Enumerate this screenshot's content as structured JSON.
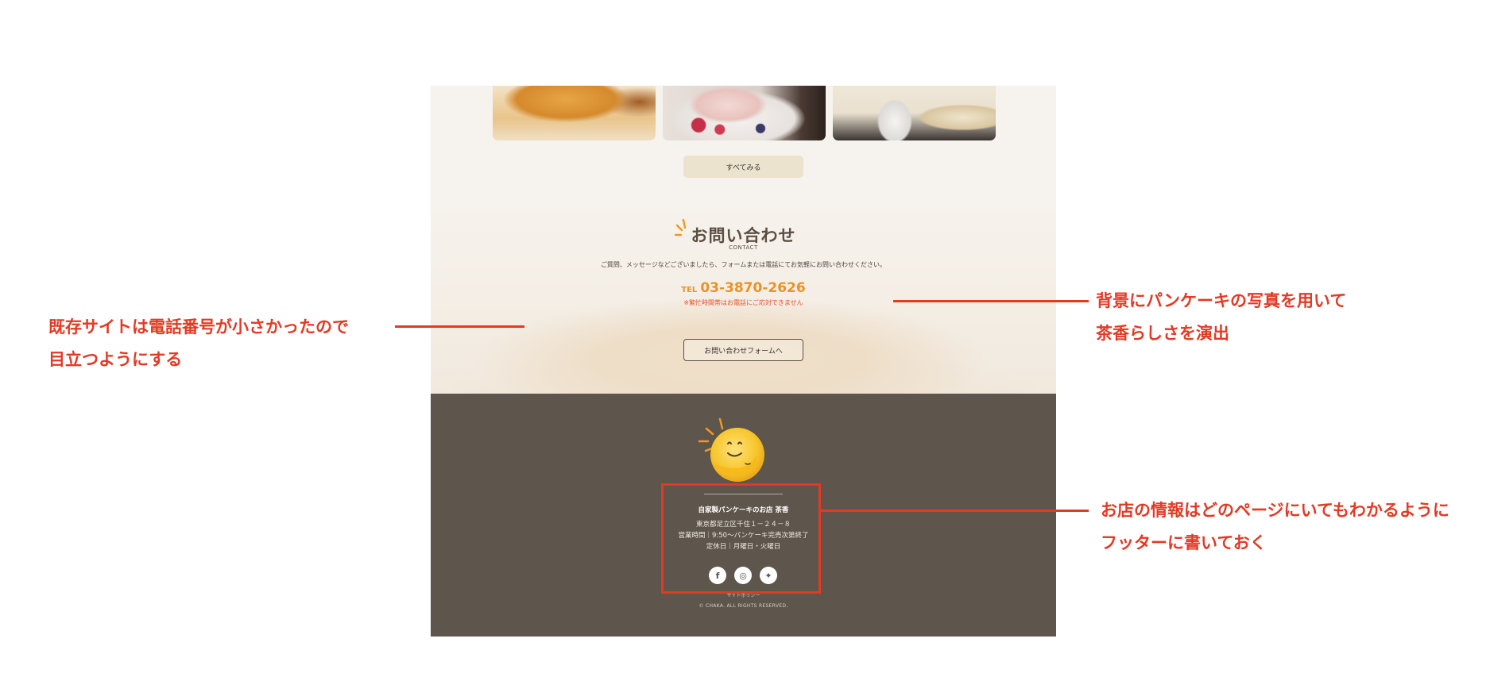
{
  "gallery": {
    "photos": [
      "pancake-caramel-photo",
      "pancake-berry-cream-photo",
      "pancake-souffle-photo"
    ],
    "see_all_label": "すべてみる"
  },
  "contact": {
    "title": "お問い合わせ",
    "subtitle": "CONTACT",
    "description": "ご質問、メッセージなどございましたら、フォームまたは電話にてお気軽にお問い合わせください。",
    "tel_label": "TEL",
    "tel_number": "03-3870-2626",
    "tel_note": "※繁忙時間帯はお電話にご応対できません",
    "form_button_label": "お問い合わせフォームへ"
  },
  "footer": {
    "shop_name": "自家製パンケーキのお店 茶香",
    "address": "東京都足立区千住１－２４－８",
    "hours": "営業時間｜9:50～パンケーキ完売次第終了",
    "holiday": "定休日｜月曜日・火曜日",
    "socials": [
      {
        "icon": "facebook-icon",
        "glyph": "f"
      },
      {
        "icon": "instagram-icon",
        "glyph": "◎"
      },
      {
        "icon": "twitter-icon",
        "glyph": "✦"
      }
    ],
    "site_policy": "サイトポリシー",
    "copyright": "© CHAKA. ALL RIGHTS RESERVED."
  },
  "annotations": {
    "left": [
      "既存サイトは電話番号が小さかったので",
      "目立つようにする"
    ],
    "right_top": [
      "背景にパンケーキの写真を用いて",
      "茶香らしさを演出"
    ],
    "right_bottom": [
      "お店の情報はどのページにいてもわかるように",
      "フッターに書いておく"
    ]
  },
  "colors": {
    "accent_orange": "#ea9322",
    "note_red": "#e8502a",
    "annotation_red": "#e23a25",
    "footer_brown": "#5e554c"
  }
}
